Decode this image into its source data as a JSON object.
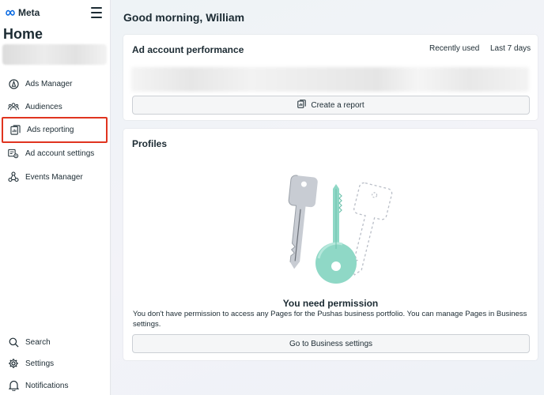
{
  "sidebar": {
    "brand": "Meta",
    "title": "Home",
    "items": [
      {
        "label": "Ads Manager",
        "icon": "compass-icon"
      },
      {
        "label": "Audiences",
        "icon": "people-icon"
      },
      {
        "label": "Ads reporting",
        "icon": "report-icon",
        "active": true
      },
      {
        "label": "Ad account settings",
        "icon": "account-settings-icon"
      },
      {
        "label": "Events Manager",
        "icon": "events-icon"
      }
    ],
    "bottom_items": [
      {
        "label": "Search",
        "icon": "search-icon"
      },
      {
        "label": "Settings",
        "icon": "gear-icon"
      },
      {
        "label": "Notifications",
        "icon": "bell-icon"
      }
    ]
  },
  "main": {
    "greeting": "Good morning, William",
    "performance": {
      "title": "Ad account performance",
      "recently_used": "Recently used",
      "range": "Last 7 days",
      "create_report": "Create a report"
    },
    "profiles": {
      "title": "Profiles",
      "permission_title": "You need permission",
      "permission_text": "You don't have permission to access any Pages for the Pushas business portfolio. You can manage Pages in Business settings.",
      "button": "Go to Business settings"
    }
  },
  "colors": {
    "active_outline": "#e0341f",
    "text": "#1c2b33",
    "key_teal": "#8fd8c6",
    "key_gray": "#c8ccd3"
  }
}
